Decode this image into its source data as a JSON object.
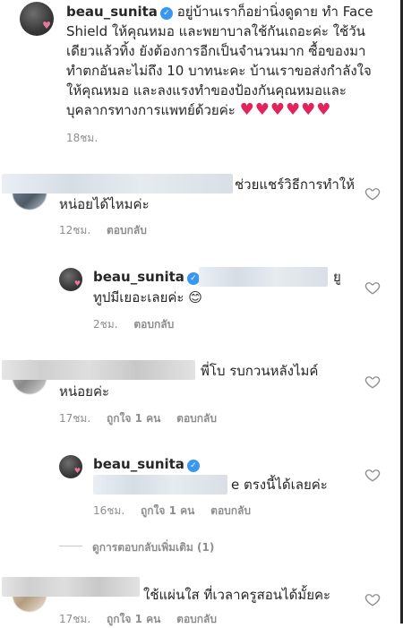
{
  "caption": {
    "username": "beau_sunita",
    "verified_mark": "✓",
    "text_lines": [
      "อยู่บ้านเราก็อย่านิ่งดูดาย ทำ Face",
      "Shield ให้คุณหมอ และพยาบาลใช้กันเถอะค่ะ ใช้วัน",
      "เดียวแล้วทิ้ง ยังต้องการอีกเป็นจำนวนมาก ซื้อของมา",
      "ทำตกอันละไม่ถึง 10 บาทนะคะ บ้านเราขอส่งกำลังใจ",
      "ให้คุณหมอ และลงแรงทำของป้องกันคุณหมอและ",
      "บุคลากรทางการแพทย์ด้วยค่ะ"
    ],
    "hearts": "♥♥♥♥♥♥",
    "time": "18ชม."
  },
  "comments": [
    {
      "line1": "ช่วยแชร์วิธีการทำให้",
      "line2": "หน่อยได้ไหมค่ะ",
      "time": "12ชม.",
      "reply_label": "ตอบกลับ"
    },
    {
      "username": "beau_sunita",
      "line1_tail": "ยู",
      "line2": "ทูปมีเยอะเลยค่ะ",
      "emoji": "😊",
      "time": "2ชม.",
      "reply_label": "ตอบกลับ"
    },
    {
      "line1": "พี่โบ รบกวนหลังไมค์",
      "line2": "หน่อยค่ะ",
      "time": "17ชม.",
      "likes": "ถูกใจ 1 คน",
      "reply_label": "ตอบกลับ"
    },
    {
      "username": "beau_sunita",
      "line1_tail": "e ตรงนี้ได้เลยค่ะ",
      "time": "16ชม.",
      "likes": "ถูกใจ 1 คน",
      "reply_label": "ตอบกลับ"
    },
    {
      "view_more": "ดูการตอบกลับเพิ่มเติม (1)"
    },
    {
      "line1": "ใช้แผ่นใส ที่เวลาครูสอนได้มั้ยคะ",
      "time": "17ชม.",
      "likes": "ถูกใจ 1 คน",
      "reply_label": "ตอบกลับ"
    }
  ],
  "colors": {
    "verified_blue": "#3897f0",
    "heart_red": "#e0245e",
    "meta_gray": "#8e8e8e"
  }
}
